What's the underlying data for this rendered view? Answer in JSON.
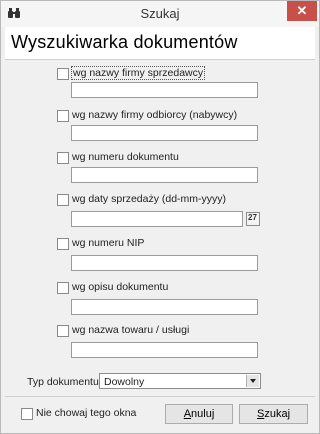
{
  "window": {
    "title": "Szukaj",
    "close_label": "✕",
    "icon": "binoculars-icon"
  },
  "header": {
    "title": "Wyszukiwarka dokumentów"
  },
  "criteria": [
    {
      "label": "wg nazwy firmy sprzedawcy",
      "checked": false,
      "value": ""
    },
    {
      "label": "wg nazwy firmy odbiorcy (nabywcy)",
      "checked": false,
      "value": ""
    },
    {
      "label": "wg numeru dokumentu",
      "checked": false,
      "value": ""
    },
    {
      "label": "wg daty sprzedaży (dd-mm-yyyy)",
      "checked": false,
      "value": ""
    },
    {
      "label": "wg numeru NIP",
      "checked": false,
      "value": ""
    },
    {
      "label": "wg opisu dokumentu",
      "checked": false,
      "value": ""
    },
    {
      "label": "wg nazwa towaru / usługi",
      "checked": false,
      "value": ""
    }
  ],
  "date_picker": {
    "icon": "calendar-icon",
    "glyph": "27"
  },
  "doc_type": {
    "label": "Typ dokumentu",
    "selected": "Dowolny"
  },
  "footer": {
    "keep_open_label": "Nie chowaj tego okna",
    "keep_open_checked": false,
    "cancel_mnemonic": "A",
    "cancel_rest": "nuluj",
    "search_mnemonic": "S",
    "search_rest": "zukaj"
  }
}
